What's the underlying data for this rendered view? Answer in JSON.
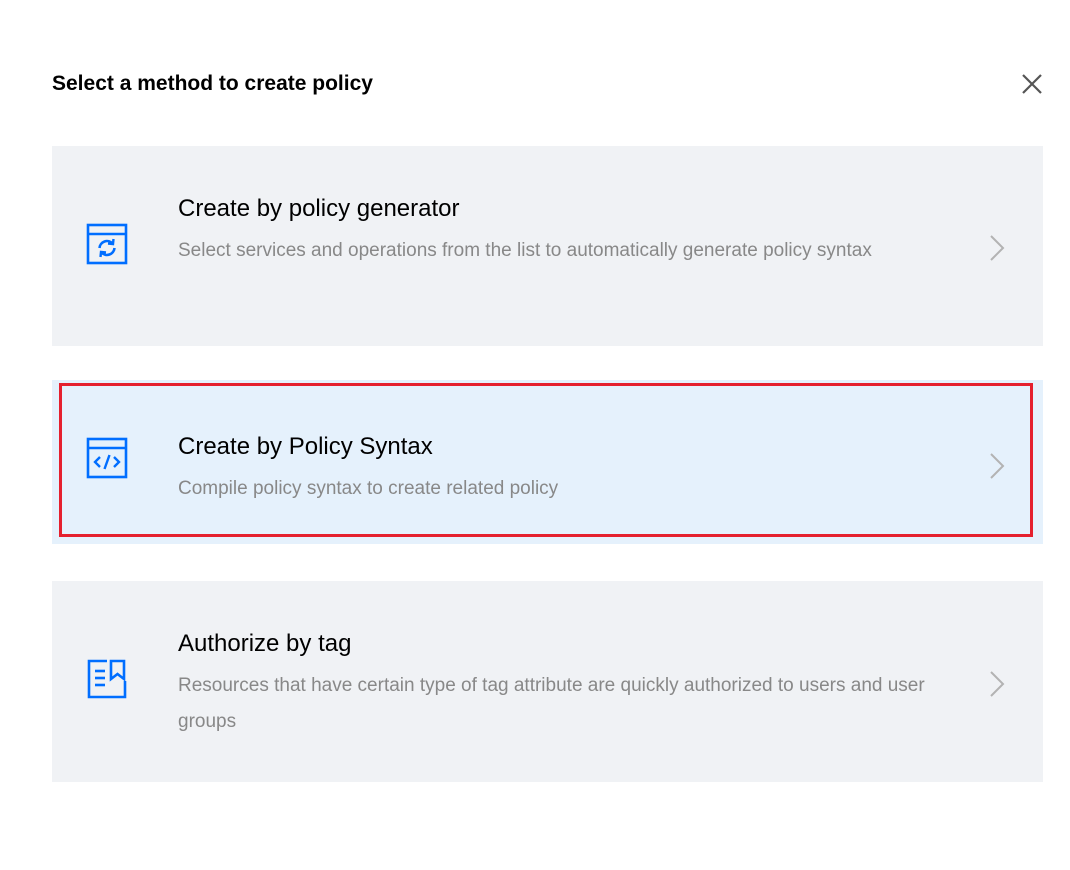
{
  "dialog": {
    "title": "Select a method to create policy",
    "close_icon": "close-icon"
  },
  "options": [
    {
      "icon": "refresh-window-icon",
      "title": "Create by policy generator",
      "description": "Select services and operations from the list to automatically generate policy syntax",
      "arrow_icon": "chevron-right-icon"
    },
    {
      "icon": "code-window-icon",
      "title": "Create by Policy Syntax",
      "description": "Compile policy syntax to create related policy",
      "arrow_icon": "chevron-right-icon",
      "highlighted": true
    },
    {
      "icon": "tag-document-icon",
      "title": "Authorize by tag",
      "description": "Resources that have certain type of tag attribute are quickly authorized to users and user groups",
      "arrow_icon": "chevron-right-icon"
    }
  ],
  "colors": {
    "accent": "#006eff",
    "option_bg": "#f0f2f5",
    "option_selected_bg": "#e5f1fc",
    "highlight_border": "#e5202e",
    "description_text": "#888888"
  }
}
